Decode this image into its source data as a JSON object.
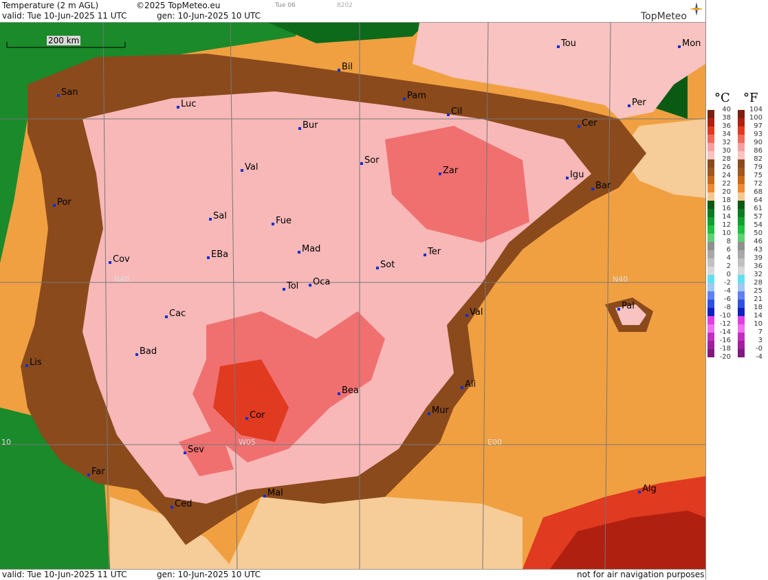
{
  "header": {
    "title": "Temperature (2 m AGL)",
    "copyright": "©2025 TopMeteo.eu",
    "run_tag": "Tue 06",
    "code": "8202",
    "valid": "valid:  Tue  10-Jun-2025  11 UTC",
    "gen": "gen: 10-Jun-2025 10 UTC",
    "logo": "TopMeteo"
  },
  "footer": {
    "valid": "valid:  Tue  10-Jun-2025  11 UTC",
    "gen": "gen: 10-Jun-2025 10 UTC",
    "note": "not for air navigation purposes"
  },
  "scale_bar": "200 km",
  "grid_labels": {
    "n40_west": "N40",
    "n40_east": "N40",
    "w05": "W05",
    "e00": "E00",
    "w10": "10"
  },
  "cities": [
    {
      "id": "tou",
      "name": "Tou"
    },
    {
      "id": "mon",
      "name": "Mon"
    },
    {
      "id": "bil",
      "name": "Bil"
    },
    {
      "id": "san",
      "name": "San"
    },
    {
      "id": "pam",
      "name": "Pam"
    },
    {
      "id": "luc",
      "name": "Luc"
    },
    {
      "id": "cil",
      "name": "Cil"
    },
    {
      "id": "per",
      "name": "Per"
    },
    {
      "id": "cer",
      "name": "Cer"
    },
    {
      "id": "bur",
      "name": "Bur"
    },
    {
      "id": "sor",
      "name": "Sor"
    },
    {
      "id": "val1",
      "name": "Val"
    },
    {
      "id": "zar",
      "name": "Zar"
    },
    {
      "id": "igu",
      "name": "Igu"
    },
    {
      "id": "bar",
      "name": "Bar"
    },
    {
      "id": "por",
      "name": "Por"
    },
    {
      "id": "sal",
      "name": "Sal"
    },
    {
      "id": "fue",
      "name": "Fue"
    },
    {
      "id": "mad",
      "name": "Mad"
    },
    {
      "id": "ter",
      "name": "Ter"
    },
    {
      "id": "cov",
      "name": "Cov"
    },
    {
      "id": "eba",
      "name": "EBa"
    },
    {
      "id": "sot",
      "name": "Sot"
    },
    {
      "id": "tol",
      "name": "Tol"
    },
    {
      "id": "oca",
      "name": "Oca"
    },
    {
      "id": "pal",
      "name": "Pal"
    },
    {
      "id": "cac",
      "name": "Cac"
    },
    {
      "id": "val2",
      "name": "Val"
    },
    {
      "id": "bad",
      "name": "Bad"
    },
    {
      "id": "lis",
      "name": "Lis"
    },
    {
      "id": "ali",
      "name": "Ali"
    },
    {
      "id": "bea",
      "name": "Bea"
    },
    {
      "id": "mur",
      "name": "Mur"
    },
    {
      "id": "cor",
      "name": "Cor"
    },
    {
      "id": "sev",
      "name": "Sev"
    },
    {
      "id": "far",
      "name": "Far"
    },
    {
      "id": "alg",
      "name": "Alg"
    },
    {
      "id": "ced",
      "name": "Ced"
    },
    {
      "id": "mal",
      "name": "Mal"
    }
  ],
  "legend": {
    "unit_c": "°C",
    "unit_f": "°F",
    "celsius": [
      "40",
      "38",
      "36",
      "34",
      "32",
      "30",
      "28",
      "26",
      "24",
      "22",
      "20",
      "18",
      "16",
      "14",
      "12",
      "10",
      "8",
      "6",
      "4",
      "2",
      "0",
      "-2",
      "-4",
      "-6",
      "-8",
      "-10",
      "-12",
      "-14",
      "-16",
      "-18",
      "-20"
    ],
    "fahrenheit": [
      "104",
      "100",
      "97",
      "93",
      "90",
      "86",
      "82",
      "79",
      "75",
      "72",
      "68",
      "64",
      "61",
      "57",
      "54",
      "50",
      "46",
      "43",
      "39",
      "36",
      "32",
      "28",
      "25",
      "21",
      "18",
      "14",
      "10",
      "7",
      "3",
      "-0",
      "-4"
    ],
    "colors": [
      "#7a1f10",
      "#b02010",
      "#e03a20",
      "#f06a5a",
      "#f7a0a0",
      "#f8c3c0",
      "#8a4a1c",
      "#a0561c",
      "#c86a18",
      "#f08a30",
      "#f6c890",
      "#0a5a14",
      "#0c7a20",
      "#10a030",
      "#20c040",
      "#60d070",
      "#909090",
      "#a8a8a8",
      "#c0c0c0",
      "#d8d8d8",
      "#60e0f0",
      "#a0c8f0",
      "#6080f0",
      "#3050e0",
      "#1020c0",
      "#e040e0",
      "#f070f0",
      "#c030c0",
      "#a020a0",
      "#801880"
    ]
  }
}
